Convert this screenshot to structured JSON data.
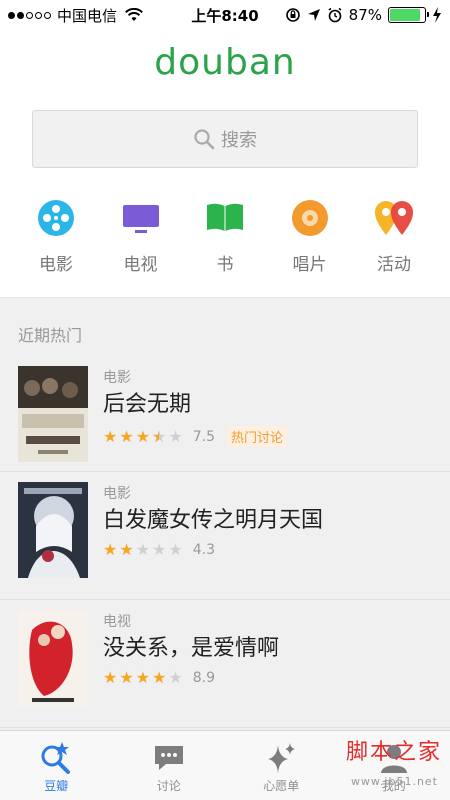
{
  "status_bar": {
    "carrier": "中国电信",
    "time": "上午8:40",
    "battery": "87%",
    "battery_level": 0.87,
    "signal_bars_filled": 2,
    "signal_bars_total": 5
  },
  "header": {
    "logo": "douban",
    "logo_color": "#2aa44a"
  },
  "search": {
    "placeholder": "搜索"
  },
  "categories": [
    {
      "label": "电影",
      "icon": "film-reel-icon",
      "color": "#2bb6e8"
    },
    {
      "label": "电视",
      "icon": "tv-icon",
      "color": "#7b5cd6"
    },
    {
      "label": "书",
      "icon": "book-icon",
      "color": "#2ab44b"
    },
    {
      "label": "唱片",
      "icon": "record-icon",
      "color": "#f39a2d"
    },
    {
      "label": "活动",
      "icon": "location-pins-icon",
      "color": "#f5a623"
    }
  ],
  "feed": {
    "section_title": "近期热门",
    "items": [
      {
        "type": "电影",
        "title": "后会无期",
        "stars": 3.5,
        "score": "7.5",
        "tag": "热门讨论"
      },
      {
        "type": "电影",
        "title": "白发魔女传之明月天国",
        "stars": 2,
        "score": "4.3",
        "tag": ""
      },
      {
        "type": "电视",
        "title": "没关系，是爱情啊",
        "stars": 4,
        "score": "8.9",
        "tag": ""
      }
    ]
  },
  "tabbar": {
    "tabs": [
      {
        "label": "豆瓣",
        "icon": "douban-search-star-icon",
        "active": true
      },
      {
        "label": "讨论",
        "icon": "chat-bubble-icon",
        "active": false
      },
      {
        "label": "心愿单",
        "icon": "sparkle-icon",
        "active": false
      },
      {
        "label": "我的",
        "icon": "person-icon",
        "active": false
      }
    ],
    "active_color": "#2d7be4"
  },
  "watermark": {
    "text": "脚本之家",
    "sub": "www.jb51.net"
  }
}
